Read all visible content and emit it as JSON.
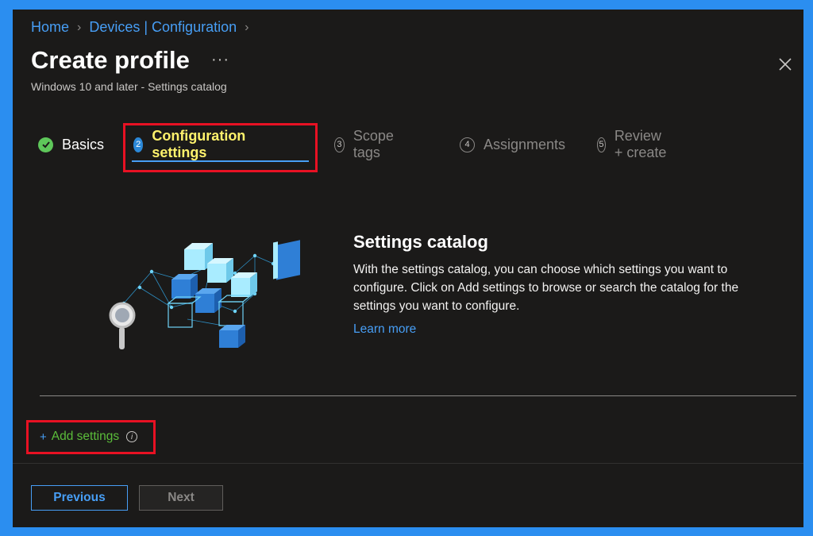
{
  "breadcrumb": {
    "home": "Home",
    "devices": "Devices | Configuration"
  },
  "header": {
    "title": "Create profile",
    "more": "···",
    "subtitle": "Windows 10 and later - Settings catalog"
  },
  "steps": [
    {
      "number": "",
      "label": "Basics",
      "state": "done"
    },
    {
      "number": "2",
      "label": "Configuration settings",
      "state": "active"
    },
    {
      "number": "3",
      "label": "Scope tags",
      "state": "future"
    },
    {
      "number": "4",
      "label": "Assignments",
      "state": "future"
    },
    {
      "number": "5",
      "label": "Review + create",
      "state": "future"
    }
  ],
  "catalog": {
    "title": "Settings catalog",
    "description": "With the settings catalog, you can choose which settings you want to configure. Click on Add settings to browse or search the catalog for the settings you want to configure.",
    "learn_more": "Learn more"
  },
  "add_settings": {
    "plus": "+",
    "label": "Add settings",
    "info": "i"
  },
  "footer": {
    "previous": "Previous",
    "next": "Next"
  },
  "icons": {
    "close": "close-icon",
    "check": "checkmark-icon",
    "info": "info-icon"
  },
  "colors": {
    "page_border": "#2b8ef0",
    "panel_bg": "#1b1a19",
    "link": "#479ef5",
    "active_step": "#fff26c",
    "done_step": "#5ec75a",
    "highlight": "#e81123",
    "add_settings_text": "#5bbd3a"
  }
}
